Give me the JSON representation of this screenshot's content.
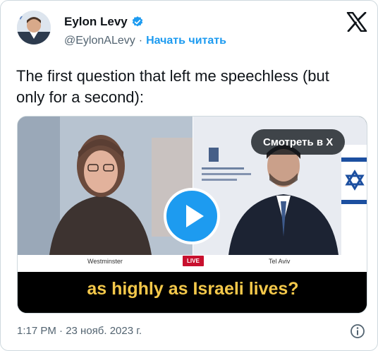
{
  "author": {
    "name": "Eylon Levy",
    "handle": "@EylonALevy",
    "separator": "·",
    "follow_label": "Начать читать",
    "verified_icon": "verified-badge-icon"
  },
  "tweet": {
    "text": "The first question that left me speechless (but only for a second):"
  },
  "video": {
    "watch_label": "Смотреть в X",
    "left_location": "Westminster",
    "live_label": "LIVE",
    "right_location": "Tel Aviv",
    "caption": "as highly as Israeli lives?",
    "play_icon": "play-icon"
  },
  "meta": {
    "timestamp": "1:17 PM · 23 нояб. 2023 г."
  },
  "colors": {
    "accent": "#1d9bf0",
    "caption_text": "#f4c84a",
    "live_badge": "#c8102e",
    "secondary_text": "#536471"
  }
}
